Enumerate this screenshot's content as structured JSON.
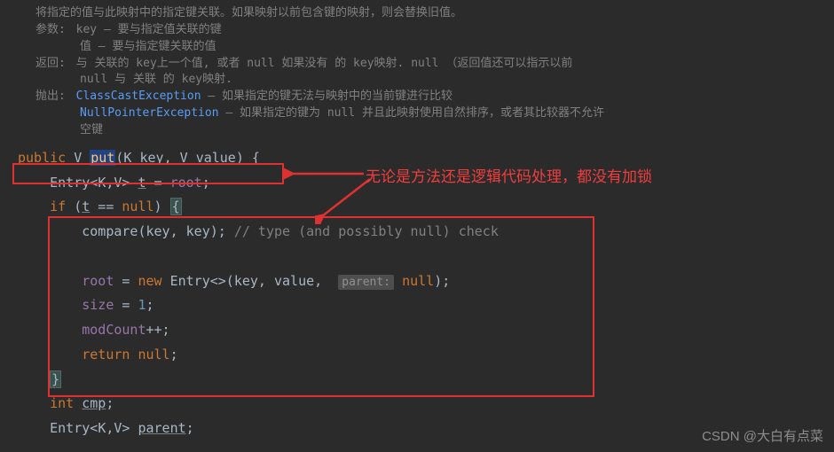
{
  "doc": {
    "summary": "将指定的值与此映射中的指定键关联。如果映射以前包含键的映射，则会替换旧值。",
    "params_label": "参数:",
    "param_key": "key – 要与指定值关联的键",
    "param_value": "值 – 要与指定键关联的值",
    "returns_label": "返回:",
    "returns_text1": "与 关联的 key上一个值, 或者 null 如果没有 的 key映射.  null  （返回值还可以指示以前",
    "returns_text2": "null 与 关联 的 key映射.",
    "throws_label": "抛出:",
    "throws1_ex": "ClassCastException",
    "throws1_text": " – 如果指定的键无法与映射中的当前键进行比较",
    "throws2_ex": "NullPointerException",
    "throws2_text": " – 如果指定的键为 null 并且此映射使用自然排序，或者其比较器不允许",
    "throws2_text2": "空键"
  },
  "code": {
    "l1_public": "public",
    "l1_V": "V",
    "l1_put": "put",
    "l1_K": "K ",
    "l1_key": "key",
    "l1_V2": "V ",
    "l1_value": "value",
    "l1_brace": "{",
    "l2_entry": "Entry",
    "l2_k": "K",
    "l2_v": "V",
    "l2_t": "t",
    "l2_eq": " = ",
    "l2_root": "root",
    "l3_if": "if",
    "l3_t": "t",
    "l3_null": "null",
    "l3_brace": "{",
    "l4_compare": "compare(key, key); ",
    "l4_comment": "// type (and possibly null) check",
    "l5_root": "root",
    "l5_new": "new",
    "l5_entry": "Entry<>(key, value, ",
    "l5_hint": "parent:",
    "l5_null": "null",
    "l6_size": "size",
    "l6_eq": " = ",
    "l6_one": "1",
    "l7_mod": "modCount",
    "l7_pp": "++;",
    "l8_return": "return",
    "l8_null": "null",
    "l9_brace": "}",
    "l10_int": "int",
    "l10_cmp": "cmp",
    "l11_entry": "Entry",
    "l11_k": "K",
    "l11_v": "V",
    "l11_parent": "parent"
  },
  "annotation": "无论是方法还是逻辑代码处理，都没有加锁",
  "watermark": "CSDN @大白有点菜"
}
